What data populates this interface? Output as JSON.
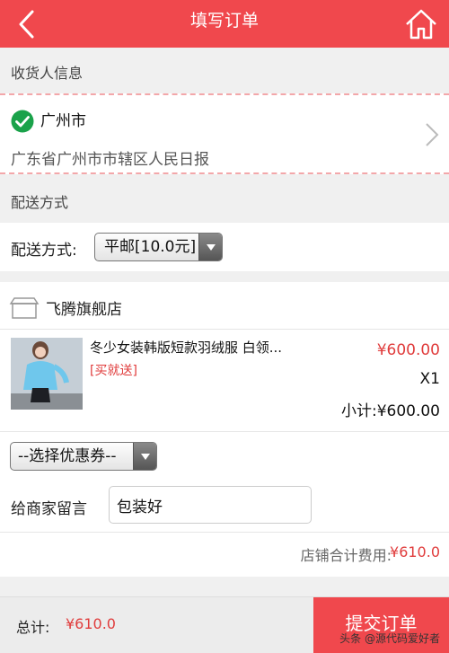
{
  "header": {
    "title": "填写订单",
    "back_icon": "chevron-left-icon",
    "home_icon": "home-icon"
  },
  "receiver": {
    "section_label": "收货人信息",
    "city": "广州市",
    "detail": "广东省广州市市辖区人民日报"
  },
  "delivery": {
    "section_label": "配送方式",
    "label": "配送方式:",
    "selected": "平邮[10.0元]"
  },
  "shop": {
    "name": "飞腾旗舰店",
    "product": {
      "name": "冬少女装韩版短款羽绒服 白领...",
      "tag": "[买就送]",
      "price": "¥600.00",
      "qty": "X1",
      "subtotal": "小计:¥600.00"
    },
    "coupon_selected": "--选择优惠券--",
    "message_label": "给商家留言",
    "message_value": "包装好",
    "total_label": "店铺合计费用:",
    "total_value": "¥610.0"
  },
  "footer": {
    "total_label": "总计:",
    "total_value": "¥610.0",
    "submit_label": "提交订单",
    "watermark": "头条 @源代码爱好者"
  },
  "colors": {
    "brand": "#f0484d",
    "price": "#e03c3c"
  }
}
